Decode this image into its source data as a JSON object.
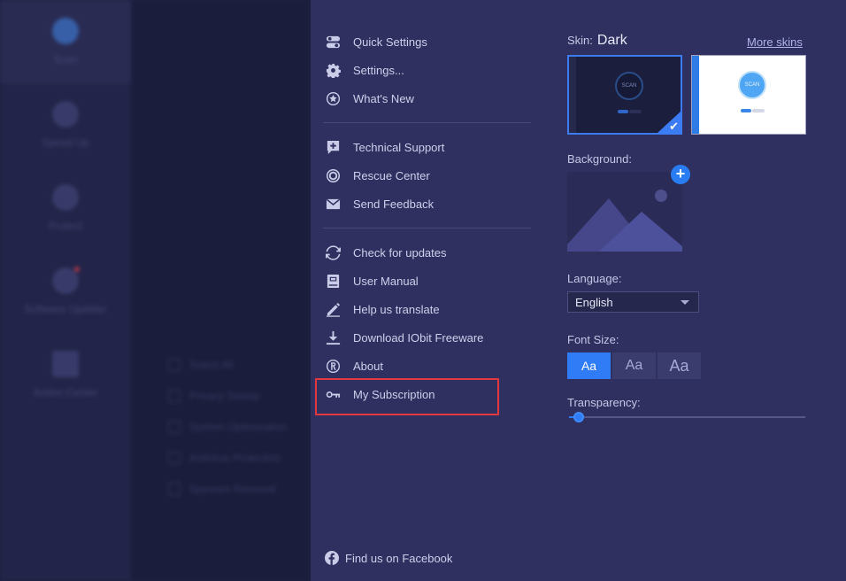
{
  "background_app": {
    "nav": [
      {
        "label": "Scan"
      },
      {
        "label": "Speed Up"
      },
      {
        "label": "Protect"
      },
      {
        "label": "Software Updater"
      },
      {
        "label": "Action Center"
      }
    ],
    "checks": [
      "Select All",
      "Privacy Sweep",
      "System Optimization",
      "Antivirus Protection",
      "Spyware Removal"
    ]
  },
  "menu": {
    "quick_settings": "Quick Settings",
    "settings": "Settings...",
    "whats_new": "What's New",
    "technical_support": "Technical Support",
    "rescue_center": "Rescue Center",
    "send_feedback": "Send Feedback",
    "check_updates": "Check for updates",
    "user_manual": "User Manual",
    "help_translate": "Help us translate",
    "download_freeware": "Download IObit Freeware",
    "about": "About",
    "my_subscription": "My Subscription"
  },
  "facebook": "Find us on Facebook",
  "skin": {
    "label": "Skin:",
    "current": "Dark",
    "more_skins": "More skins",
    "thumb_text": "SCAN",
    "selected": "dark"
  },
  "background": {
    "label": "Background:",
    "add_icon": "plus-icon"
  },
  "language": {
    "label": "Language:",
    "value": "English"
  },
  "font_size": {
    "label": "Font Size:",
    "options": [
      "Aa",
      "Aa",
      "Aa"
    ],
    "selected_index": 0
  },
  "transparency": {
    "label": "Transparency:",
    "value": 0.04
  },
  "colors": {
    "panel": "#2f305f",
    "accent": "#2f7cf6",
    "highlight_box": "#e0383c"
  }
}
